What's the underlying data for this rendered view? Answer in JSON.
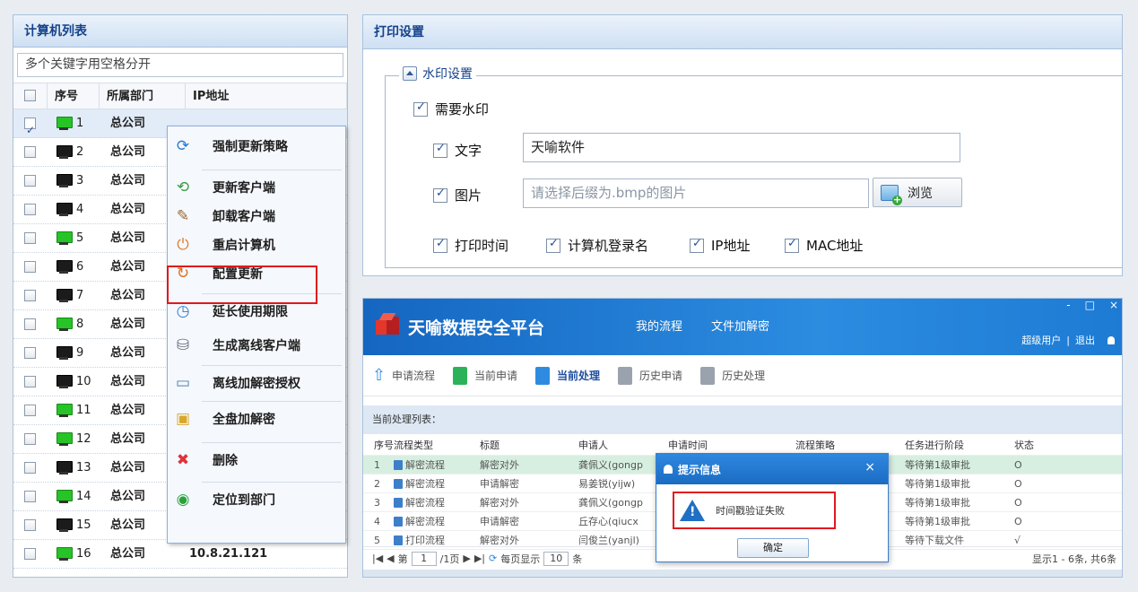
{
  "computer_list": {
    "title": "计算机列表",
    "search_placeholder": "多个关键字用空格分开",
    "columns": [
      "序号",
      "所属部门",
      "IP地址"
    ],
    "rows": [
      {
        "no": "1",
        "dept": "总公司",
        "online": true,
        "checked": true
      },
      {
        "no": "2",
        "dept": "总公司",
        "online": false
      },
      {
        "no": "3",
        "dept": "总公司",
        "online": false
      },
      {
        "no": "4",
        "dept": "总公司",
        "online": false
      },
      {
        "no": "5",
        "dept": "总公司",
        "online": true
      },
      {
        "no": "6",
        "dept": "总公司",
        "online": false
      },
      {
        "no": "7",
        "dept": "总公司",
        "online": false
      },
      {
        "no": "8",
        "dept": "总公司",
        "online": true
      },
      {
        "no": "9",
        "dept": "总公司",
        "online": false
      },
      {
        "no": "10",
        "dept": "总公司",
        "online": false
      },
      {
        "no": "11",
        "dept": "总公司",
        "online": true
      },
      {
        "no": "12",
        "dept": "总公司",
        "online": true
      },
      {
        "no": "13",
        "dept": "总公司",
        "online": false
      },
      {
        "no": "14",
        "dept": "总公司",
        "online": true
      },
      {
        "no": "15",
        "dept": "总公司",
        "online": false
      },
      {
        "no": "16",
        "dept": "总公司",
        "online": true,
        "ip": "10.8.21.121"
      }
    ]
  },
  "context_menu": {
    "items": [
      {
        "label": "强制更新策略",
        "icon": "refresh-icon"
      },
      {
        "label": "更新客户端",
        "icon": "update-client-icon"
      },
      {
        "label": "卸载客户端",
        "icon": "broom-icon"
      },
      {
        "label": "重启计算机",
        "icon": "power-icon"
      },
      {
        "label": "配置更新",
        "icon": "config-update-icon"
      },
      {
        "label": "延长使用期限",
        "icon": "clock-icon"
      },
      {
        "label": "生成离线客户端",
        "icon": "offline-disk-icon"
      },
      {
        "label": "离线加解密授权",
        "icon": "laptop-key-icon"
      },
      {
        "label": "全盘加解密",
        "icon": "folder-lock-icon"
      },
      {
        "label": "删除",
        "icon": "delete-icon"
      },
      {
        "label": "定位到部门",
        "icon": "locate-icon"
      }
    ]
  },
  "print_settings": {
    "title": "打印设置",
    "watermark_legend": "水印设置",
    "need_watermark": "需要水印",
    "text_label": "文字",
    "text_value": "天喻软件",
    "image_label": "图片",
    "image_placeholder": "请选择后缀为.bmp的图片",
    "browse": "浏览",
    "options": [
      "打印时间",
      "计算机登录名",
      "IP地址",
      "MAC地址"
    ]
  },
  "platform": {
    "brand": "天喻数据安全平台",
    "nav": [
      "我的流程",
      "文件加解密"
    ],
    "window_controls": [
      "-",
      "□",
      "×"
    ],
    "user": "超级用户",
    "logout": "退出",
    "tabs": [
      "申请流程",
      "当前申请",
      "当前处理",
      "历史申请",
      "历史处理"
    ],
    "list_title": "当前处理列表：",
    "headers": [
      "序号",
      "流程类型",
      "标题",
      "申请人",
      "申请时间",
      "流程策略",
      "任务进行阶段",
      "状态"
    ],
    "rows": [
      {
        "no": "1",
        "type": "解密流程",
        "title": "解密对外",
        "applicant": "龚佩义(gongp",
        "stage": "等待第1级审批",
        "status": "O"
      },
      {
        "no": "2",
        "type": "解密流程",
        "title": "申请解密",
        "applicant": "易姜锐(yijw)",
        "stage": "等待第1级审批",
        "status": "O"
      },
      {
        "no": "3",
        "type": "解密流程",
        "title": "解密对外",
        "applicant": "龚佩义(gongp",
        "stage": "等待第1级审批",
        "status": "O"
      },
      {
        "no": "4",
        "type": "解密流程",
        "title": "申请解密",
        "applicant": "丘存心(qiucx",
        "stage": "等待第1级审批",
        "status": "O"
      },
      {
        "no": "5",
        "type": "打印流程",
        "title": "解密对外",
        "applicant": "闫俊兰(yanjl)",
        "stage": "等待下载文件",
        "status": "√"
      }
    ],
    "pager": {
      "page_prefix": "第",
      "page": "1",
      "page_suffix": "/1页",
      "per_page_label": "每页显示",
      "per_page": "10",
      "per_page_unit": "条",
      "summary": "显示1 - 6条, 共6条"
    },
    "dialog": {
      "title": "提示信息",
      "message": "时间戳验证失败",
      "ok": "确定"
    }
  }
}
